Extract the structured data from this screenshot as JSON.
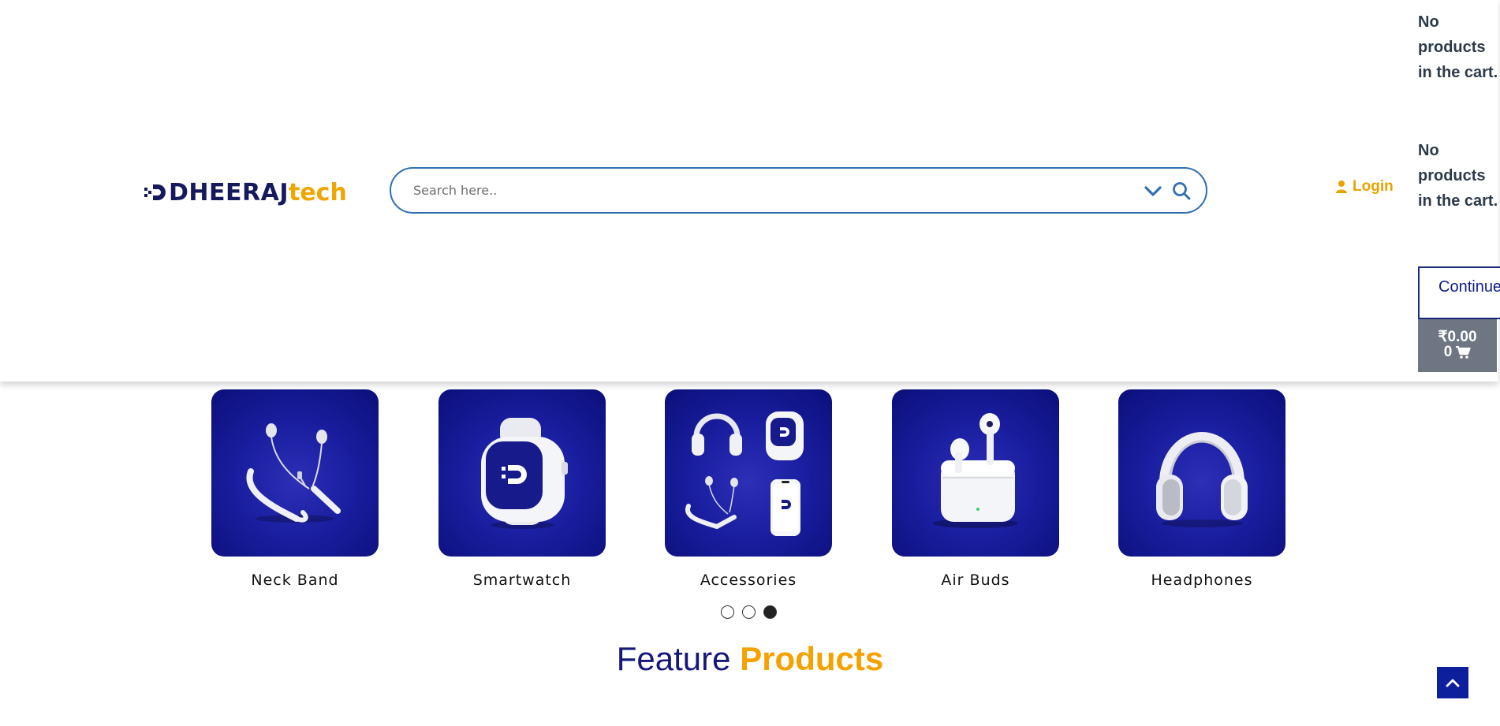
{
  "brand": {
    "logo_text_primary": "DHEERAJ",
    "logo_text_secondary": "tech",
    "primary_color": "#141a5c",
    "accent_color": "#f0a500"
  },
  "search": {
    "placeholder": "Search here..",
    "value": "",
    "category_toggle_icon": "chevron-down-icon",
    "submit_icon": "search-icon"
  },
  "account": {
    "login_label": "Login",
    "icon": "user-icon"
  },
  "cart": {
    "empty_message_1": "No products in the cart.",
    "empty_message_2": "No products in the cart.",
    "continue_label": "Continue Shopping",
    "total": "₹0.00",
    "count": "0",
    "icon": "cart-icon"
  },
  "categories": [
    {
      "label": "Neck Band",
      "icon": "neckband-earphones-icon"
    },
    {
      "label": "Smartwatch",
      "icon": "smartwatch-icon"
    },
    {
      "label": "Accessories",
      "icon": "accessories-icon"
    },
    {
      "label": "Air Buds",
      "icon": "earbuds-icon"
    },
    {
      "label": "Headphones",
      "icon": "headphones-icon"
    }
  ],
  "carousel": {
    "pages": 3,
    "active_page": 3
  },
  "feature": {
    "title_part1": "Feature",
    "title_part2": "Products"
  },
  "scroll_top": {
    "icon": "chevron-up-icon"
  }
}
